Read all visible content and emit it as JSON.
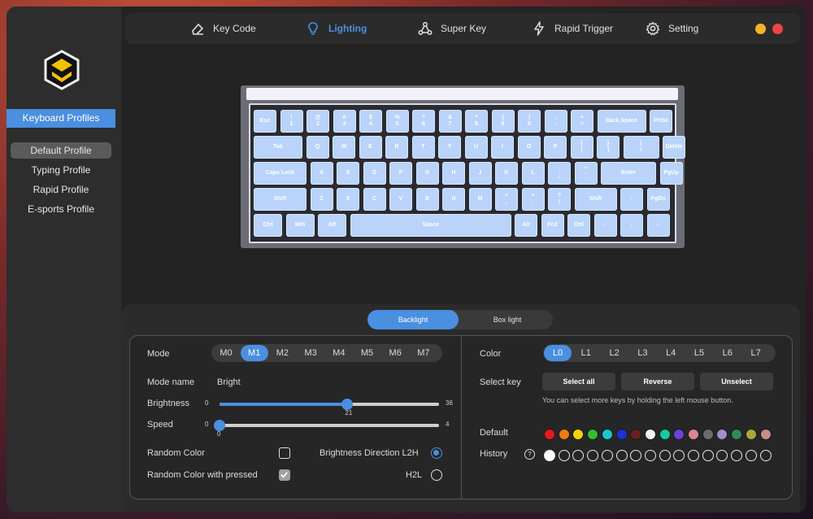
{
  "sidebar": {
    "header": "Keyboard Profiles",
    "profiles": [
      "Default Profile",
      "Typing Profile",
      "Rapid Profile",
      "E-sports Profile"
    ]
  },
  "tabs": [
    {
      "label": "Key Code",
      "icon": "eraser-icon"
    },
    {
      "label": "Lighting",
      "icon": "bulb-icon"
    },
    {
      "label": "Super Key",
      "icon": "nodes-icon"
    },
    {
      "label": "Rapid Trigger",
      "icon": "bolt-icon"
    },
    {
      "label": "Setting",
      "icon": "gear-icon"
    }
  ],
  "keys": {
    "row1": [
      "Esc",
      "!\n1",
      "@\n2",
      "#\n3",
      "$\n4",
      "%\n5",
      "^\n6",
      "&\n7",
      "*\n8",
      "(\n9",
      ")\n0",
      "_\n-",
      "+\n=",
      "Back Space",
      "PrtSc"
    ],
    "row2": [
      "Tab",
      "Q",
      "W",
      "E",
      "R",
      "T",
      "Y",
      "U",
      "I",
      "O",
      "P",
      "{\n[",
      "}\n]",
      "|\n\\",
      "Delete"
    ],
    "row3": [
      "Caps Lock",
      "A",
      "S",
      "D",
      "F",
      "G",
      "H",
      "J",
      "K",
      "L",
      ":\n;",
      "\"\n'",
      "Enter",
      "PgUp"
    ],
    "row4": [
      "Shift",
      "Z",
      "X",
      "C",
      "V",
      "B",
      "N",
      "M",
      "<\n,",
      ">\n.",
      "?\n/",
      "Shift",
      "↑",
      "PgDn"
    ],
    "row5": [
      "Ctrl",
      "Win",
      "Alt",
      "Space",
      "Alt",
      "Fn2",
      "Ctrl",
      "←",
      "↓",
      "→"
    ]
  },
  "panel": {
    "tabs": [
      "Backlight",
      "Box light"
    ],
    "mode_label": "Mode",
    "modes": [
      "M0",
      "M1",
      "M2",
      "M3",
      "M4",
      "M5",
      "M6",
      "M7"
    ],
    "mode_name_label": "Mode name",
    "mode_name": "Bright",
    "brightness_label": "Brightness",
    "brightness": {
      "min": "0",
      "max": "36",
      "value": "21",
      "fraction": 0.583
    },
    "speed_label": "Speed",
    "speed": {
      "min": "0",
      "max": "4",
      "value": "0",
      "fraction": 0.0
    },
    "random_color_label": "Random Color",
    "random_color_pressed_label": "Random Color with pressed",
    "direction_l2h_label": "Brightness Direction L2H",
    "direction_h2l_label": "H2L",
    "color_label": "Color",
    "layers": [
      "L0",
      "L1",
      "L2",
      "L3",
      "L4",
      "L5",
      "L6",
      "L7"
    ],
    "select_key_label": "Select key",
    "select_all": "Select all",
    "reverse": "Reverse",
    "unselect": "Unselect",
    "hint": "You can select more keys by holding the left mouse button.",
    "default_label": "Default",
    "history_label": "History",
    "history_help": "?",
    "default_colors": [
      "#e21b1b",
      "#f07b12",
      "#f2d500",
      "#2fbf2f",
      "#19c7c9",
      "#1f2fd6",
      "#6b1f1f",
      "#f5f5f5",
      "#17c9a0",
      "#6f3fd9",
      "#d9898d",
      "#6b6b6b",
      "#9b8fce",
      "#2f8a5c",
      "#a6a83a",
      "#c98a8a"
    ],
    "history_colors": [
      "#ffffff",
      "",
      "",
      "",
      "",
      "",
      "",
      "",
      "",
      "",
      "",
      "",
      "",
      "",
      "",
      ""
    ]
  }
}
